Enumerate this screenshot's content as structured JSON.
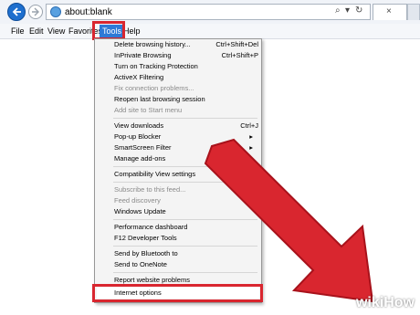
{
  "browser": {
    "address": "about:blank",
    "address_tools": [
      "⌕",
      "▾",
      "↻"
    ],
    "tab_close": "×",
    "accent": "#2e7ad6",
    "highlight": "#d9262f"
  },
  "menubar": {
    "items": [
      "File",
      "Edit",
      "View",
      "Favorites",
      "Tools",
      "Help"
    ],
    "active": "Tools"
  },
  "tools_menu": {
    "items": [
      {
        "label": "Delete browsing history...",
        "shortcut": "Ctrl+Shift+Del"
      },
      {
        "label": "InPrivate Browsing",
        "shortcut": "Ctrl+Shift+P"
      },
      {
        "label": "Turn on Tracking Protection"
      },
      {
        "label": "ActiveX Filtering"
      },
      {
        "label": "Fix connection problems...",
        "disabled": true
      },
      {
        "label": "Reopen last browsing session"
      },
      {
        "label": "Add site to Start menu",
        "disabled": true
      },
      {
        "label": "View downloads",
        "shortcut": "Ctrl+J"
      },
      {
        "label": "Pop-up Blocker",
        "submenu": true
      },
      {
        "label": "SmartScreen Filter",
        "submenu": true
      },
      {
        "label": "Manage add-ons"
      },
      {
        "label": "Compatibility View settings"
      },
      {
        "label": "Subscribe to this feed...",
        "disabled": true
      },
      {
        "label": "Feed discovery",
        "disabled": true
      },
      {
        "label": "Windows Update"
      },
      {
        "label": "Performance dashboard"
      },
      {
        "label": "F12 Developer Tools"
      },
      {
        "label": "Send by Bluetooth to"
      },
      {
        "label": "Send to OneNote"
      },
      {
        "label": "Report website problems"
      },
      {
        "label": "Internet options"
      }
    ],
    "submenu_glyph": "▸"
  },
  "watermark": {
    "wiki": "wiki",
    "how": "How"
  }
}
